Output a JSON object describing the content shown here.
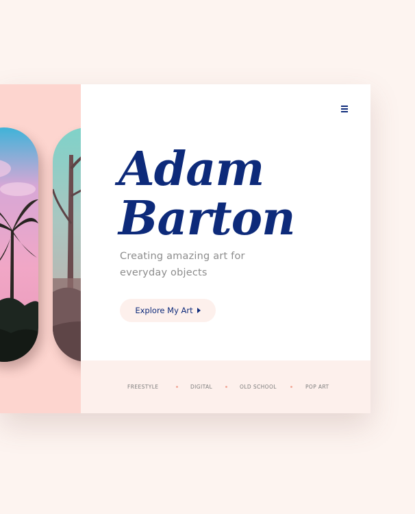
{
  "hero": {
    "title_line1": "Adam",
    "title_line2": "Barton",
    "subtitle": "Creating amazing art for everyday objects",
    "cta_label": "Explore My Art"
  },
  "categories": [
    "FREESTYLE",
    "DIGITAL",
    "OLD SCHOOL",
    "POP ART"
  ],
  "colors": {
    "page_bg": "#fdf4f0",
    "accent_navy": "#0d2a7a",
    "pink_panel": "#fdd5cf",
    "footer_band": "#fdf0ec",
    "dot": "#f2a99a"
  },
  "icons": {
    "menu": "hamburger-menu-icon",
    "cta": "play-triangle-icon"
  }
}
